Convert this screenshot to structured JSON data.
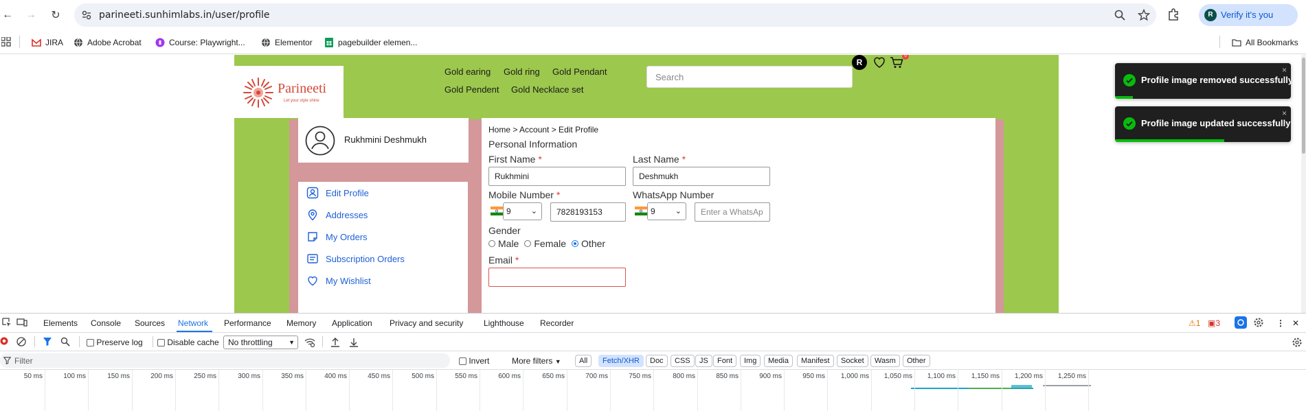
{
  "browser": {
    "url": "parineeti.sunhimlabs.in/user/profile",
    "verify_label": "Verify it's you",
    "verify_avatar": "R",
    "bookmarks": [
      "JIRA",
      "Adobe Acrobat",
      "Course: Playwright...",
      "Elementor",
      "pagebuilder elemen..."
    ],
    "all_bookmarks": "All Bookmarks"
  },
  "site": {
    "logo_text": "Parineeti",
    "logo_tagline": "Let your style shine",
    "menu": [
      "Gold earing",
      "Gold ring",
      "Gold Pendant",
      "Gold Pendent",
      "Gold Necklace set"
    ],
    "search_placeholder": "Search",
    "user_initial": "R",
    "cart_count": "0",
    "brand_color": "#9cc84d",
    "panel_color": "#d4979a"
  },
  "profile": {
    "user_name": "Rukhmini Deshmukh",
    "sidebar": [
      "Edit Profile",
      "Addresses",
      "My Orders",
      "Subscription Orders",
      "My Wishlist"
    ],
    "breadcrumb": "Home > Account > Edit Profile",
    "section_title": "Personal Information",
    "first_name_label": "First Name",
    "first_name": "Rukhmini",
    "last_name_label": "Last Name",
    "last_name": "Deshmukh",
    "mobile_label": "Mobile Number",
    "mobile_code": "9",
    "mobile": "7828193153",
    "whatsapp_label": "WhatsApp Number",
    "whatsapp_code": "9",
    "whatsapp_placeholder": "Enter a WhatsAp",
    "gender_label": "Gender",
    "gender_options": [
      "Male",
      "Female",
      "Other"
    ],
    "gender_selected": "Other",
    "email_label": "Email",
    "required_mark": "*"
  },
  "toasts": [
    {
      "message": "Profile image removed successfully!",
      "close": "×",
      "progress": 0.1
    },
    {
      "message": "Profile image updated successfully!",
      "close": "×",
      "progress": 0.62
    }
  ],
  "devtools": {
    "tabs": [
      "Elements",
      "Console",
      "Sources",
      "Network",
      "Performance",
      "Memory",
      "Application",
      "Privacy and security",
      "Lighthouse",
      "Recorder"
    ],
    "active_tab": "Network",
    "warnings": "1",
    "errors": "3",
    "preserve_log": "Preserve log",
    "disable_cache": "Disable cache",
    "throttling": "No throttling",
    "filter_placeholder": "Filter",
    "invert": "Invert",
    "more_filters": "More filters",
    "types": [
      "All",
      "Fetch/XHR",
      "Doc",
      "CSS",
      "JS",
      "Font",
      "Img",
      "Media",
      "Manifest",
      "Socket",
      "Wasm",
      "Other"
    ],
    "active_type": "Fetch/XHR",
    "ticks": [
      "50 ms",
      "100 ms",
      "150 ms",
      "200 ms",
      "250 ms",
      "300 ms",
      "350 ms",
      "400 ms",
      "450 ms",
      "500 ms",
      "550 ms",
      "600 ms",
      "650 ms",
      "700 ms",
      "750 ms",
      "800 ms",
      "850 ms",
      "900 ms",
      "950 ms",
      "1,000 ms",
      "1,050 ms",
      "1,100 ms",
      "1,150 ms",
      "1,200 ms",
      "1,250 ms"
    ]
  }
}
